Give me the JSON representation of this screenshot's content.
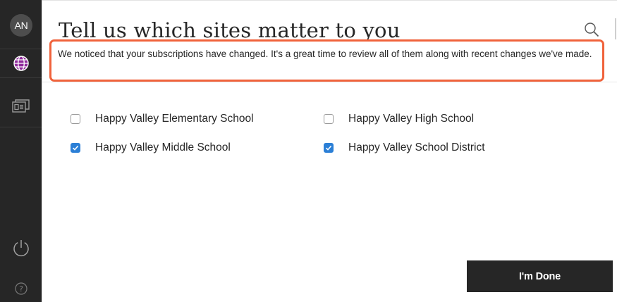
{
  "rail": {
    "avatar_initials": "AN",
    "icons": [
      "globe-icon",
      "news-feed-icon",
      "power-icon",
      "help-icon"
    ]
  },
  "header": {
    "title": "Tell us which sites matter to you",
    "search_icon": "search-icon"
  },
  "notice": {
    "text": "We noticed that your subscriptions have changed. It's a great time to review all of them along with recent changes we've made.",
    "border_color": "#f0623b"
  },
  "sites": [
    {
      "label": "Happy Valley Elementary School",
      "checked": false
    },
    {
      "label": "Happy Valley High School",
      "checked": false
    },
    {
      "label": "Happy Valley Middle School",
      "checked": true
    },
    {
      "label": "Happy Valley School District",
      "checked": true
    }
  ],
  "done_button": {
    "label": "I'm Done"
  },
  "colors": {
    "rail_background": "#262626",
    "checkbox_checked": "#2b7fd6",
    "button_background": "#262626"
  }
}
